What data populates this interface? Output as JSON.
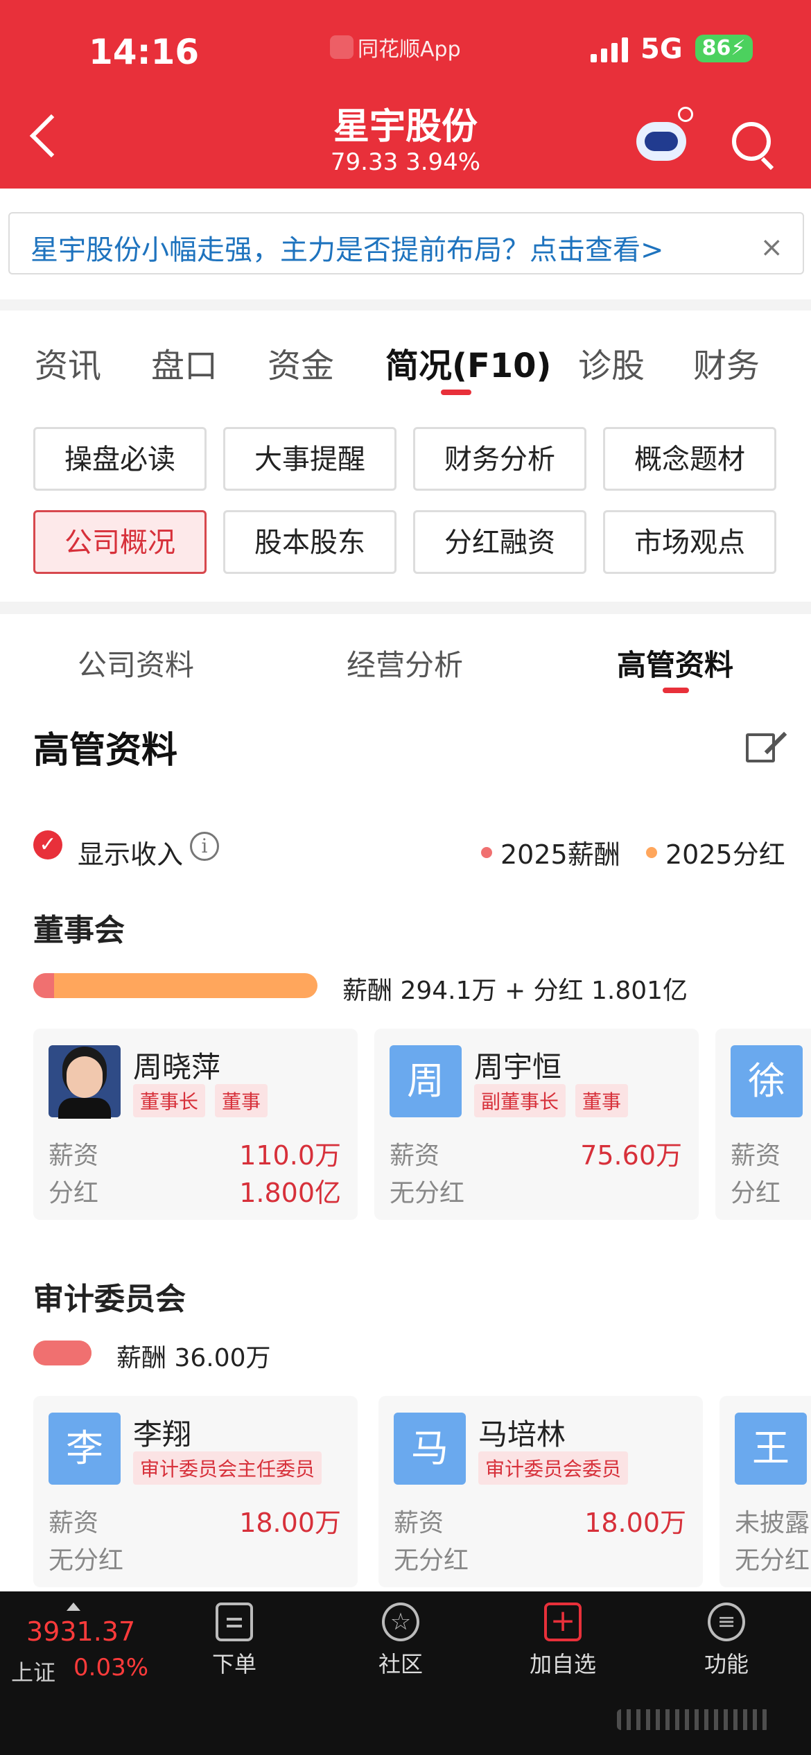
{
  "status_bar": {
    "time": "14:16",
    "app": "同花顺App",
    "network": "5G",
    "battery": "86"
  },
  "header": {
    "stock_name": "星宇股份",
    "price_change": "79.33 3.94%"
  },
  "banner": {
    "text": "星宇股份小幅走强，主力是否提前布局？点击查看>",
    "close": "×"
  },
  "main_tabs": [
    "资讯",
    "盘口",
    "资金",
    "简况(F10)",
    "诊股",
    "财务"
  ],
  "active_main_tab": "简况(F10)",
  "grid_buttons": [
    "操盘必读",
    "大事提醒",
    "财务分析",
    "概念题材",
    "公司概况",
    "股本股东",
    "分红融资",
    "市场观点"
  ],
  "active_grid_button": "公司概况",
  "sub_tabs": [
    "公司资料",
    "经营分析",
    "高管资料"
  ],
  "active_sub_tab": "高管资料",
  "section": {
    "title": "高管资料",
    "show_income_label": "显示收入",
    "show_income_checked": true,
    "legend": [
      {
        "label": "2025薪酬",
        "color": "#f07070"
      },
      {
        "label": "2025分红",
        "color": "#ffa65c"
      }
    ]
  },
  "board": {
    "title": "董事会",
    "summary": "薪酬 294.1万 + 分红 1.801亿",
    "salary_fraction": 0.072,
    "members": [
      {
        "avatar": "",
        "name": "周晓萍",
        "tags": [
          "董事长",
          "董事"
        ],
        "salary_label": "薪资",
        "salary": "110.0万",
        "dividend_label": "分红",
        "dividend": "1.800亿"
      },
      {
        "avatar": "周",
        "name": "周宇恒",
        "tags": [
          "副董事长",
          "董事"
        ],
        "salary_label": "薪资",
        "salary": "75.60万",
        "dividend_label": "无分红",
        "dividend": ""
      },
      {
        "avatar": "徐",
        "name": "",
        "tags": [],
        "salary_label": "薪资",
        "salary": "",
        "dividend_label": "分红",
        "dividend": ""
      }
    ]
  },
  "audit": {
    "title": "审计委员会",
    "summary": "薪酬 36.00万",
    "salary_fraction": 1.0,
    "members": [
      {
        "avatar": "李",
        "name": "李翔",
        "tags": [
          "审计委员会主任委员"
        ],
        "salary_label": "薪资",
        "salary": "18.00万",
        "dividend_label": "无分红"
      },
      {
        "avatar": "马",
        "name": "马培林",
        "tags": [
          "审计委员会委员"
        ],
        "salary_label": "薪资",
        "salary": "18.00万",
        "dividend_label": "无分红"
      },
      {
        "avatar": "王",
        "name": "",
        "tags": [],
        "salary_label": "未披露",
        "salary": "",
        "dividend_label": "无分红"
      }
    ]
  },
  "bottom_bar": {
    "index_value": "3931.37",
    "index_name": "上证",
    "index_change": "0.03%",
    "nav": [
      "下单",
      "社区",
      "加自选",
      "功能"
    ]
  }
}
